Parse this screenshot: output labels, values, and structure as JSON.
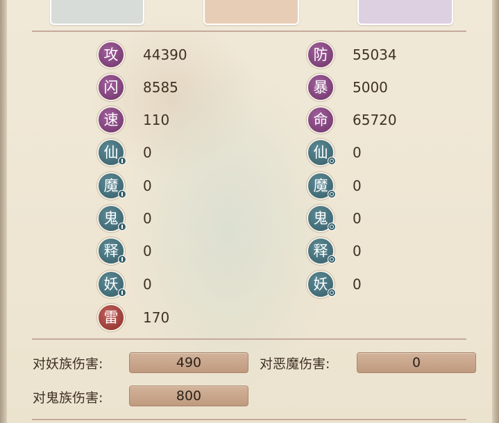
{
  "attributes": {
    "left": [
      {
        "icon": "攻",
        "value": "44390"
      },
      {
        "icon": "闪",
        "value": "8585"
      },
      {
        "icon": "速",
        "value": "110"
      },
      {
        "icon": "仙",
        "value": "0"
      },
      {
        "icon": "魔",
        "value": "0"
      },
      {
        "icon": "鬼",
        "value": "0"
      },
      {
        "icon": "释",
        "value": "0"
      },
      {
        "icon": "妖",
        "value": "0"
      },
      {
        "icon": "雷",
        "value": "170"
      }
    ],
    "right": [
      {
        "icon": "防",
        "value": "55034"
      },
      {
        "icon": "暴",
        "value": "5000"
      },
      {
        "icon": "命",
        "value": "65720"
      },
      {
        "icon": "仙",
        "value": "0"
      },
      {
        "icon": "魔",
        "value": "0"
      },
      {
        "icon": "鬼",
        "value": "0"
      },
      {
        "icon": "释",
        "value": "0"
      },
      {
        "icon": "妖",
        "value": "0"
      }
    ]
  },
  "damage": [
    {
      "label": "对妖族伤害:",
      "value": "490"
    },
    {
      "label": "对恶魔伤害:",
      "value": "0"
    },
    {
      "label": "对鬼族伤害:",
      "value": "800"
    }
  ],
  "colors": {
    "badge_purple": "#7e3f78",
    "badge_teal": "#41707b",
    "badge_red": "#9e3a35",
    "damage_bar": "#c8a68b",
    "background": "#efe6d4"
  }
}
